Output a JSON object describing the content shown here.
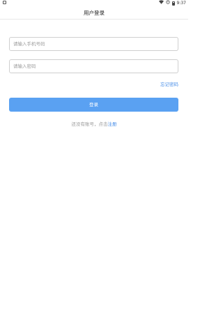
{
  "status_bar": {
    "time": "9:37",
    "icons": [
      "wifi-icon",
      "signal-icon",
      "battery-icon"
    ]
  },
  "header": {
    "title": "用户登录"
  },
  "form": {
    "phone_placeholder": "请输入手机号码",
    "phone_value": "",
    "password_placeholder": "请输入密码",
    "password_value": "",
    "forgot_label": "忘记密码",
    "login_label": "登录",
    "register_prompt": "还没有账号，点击",
    "register_link": "注册"
  },
  "colors": {
    "accent": "#5aa1f2",
    "link": "#4a8fe8"
  }
}
